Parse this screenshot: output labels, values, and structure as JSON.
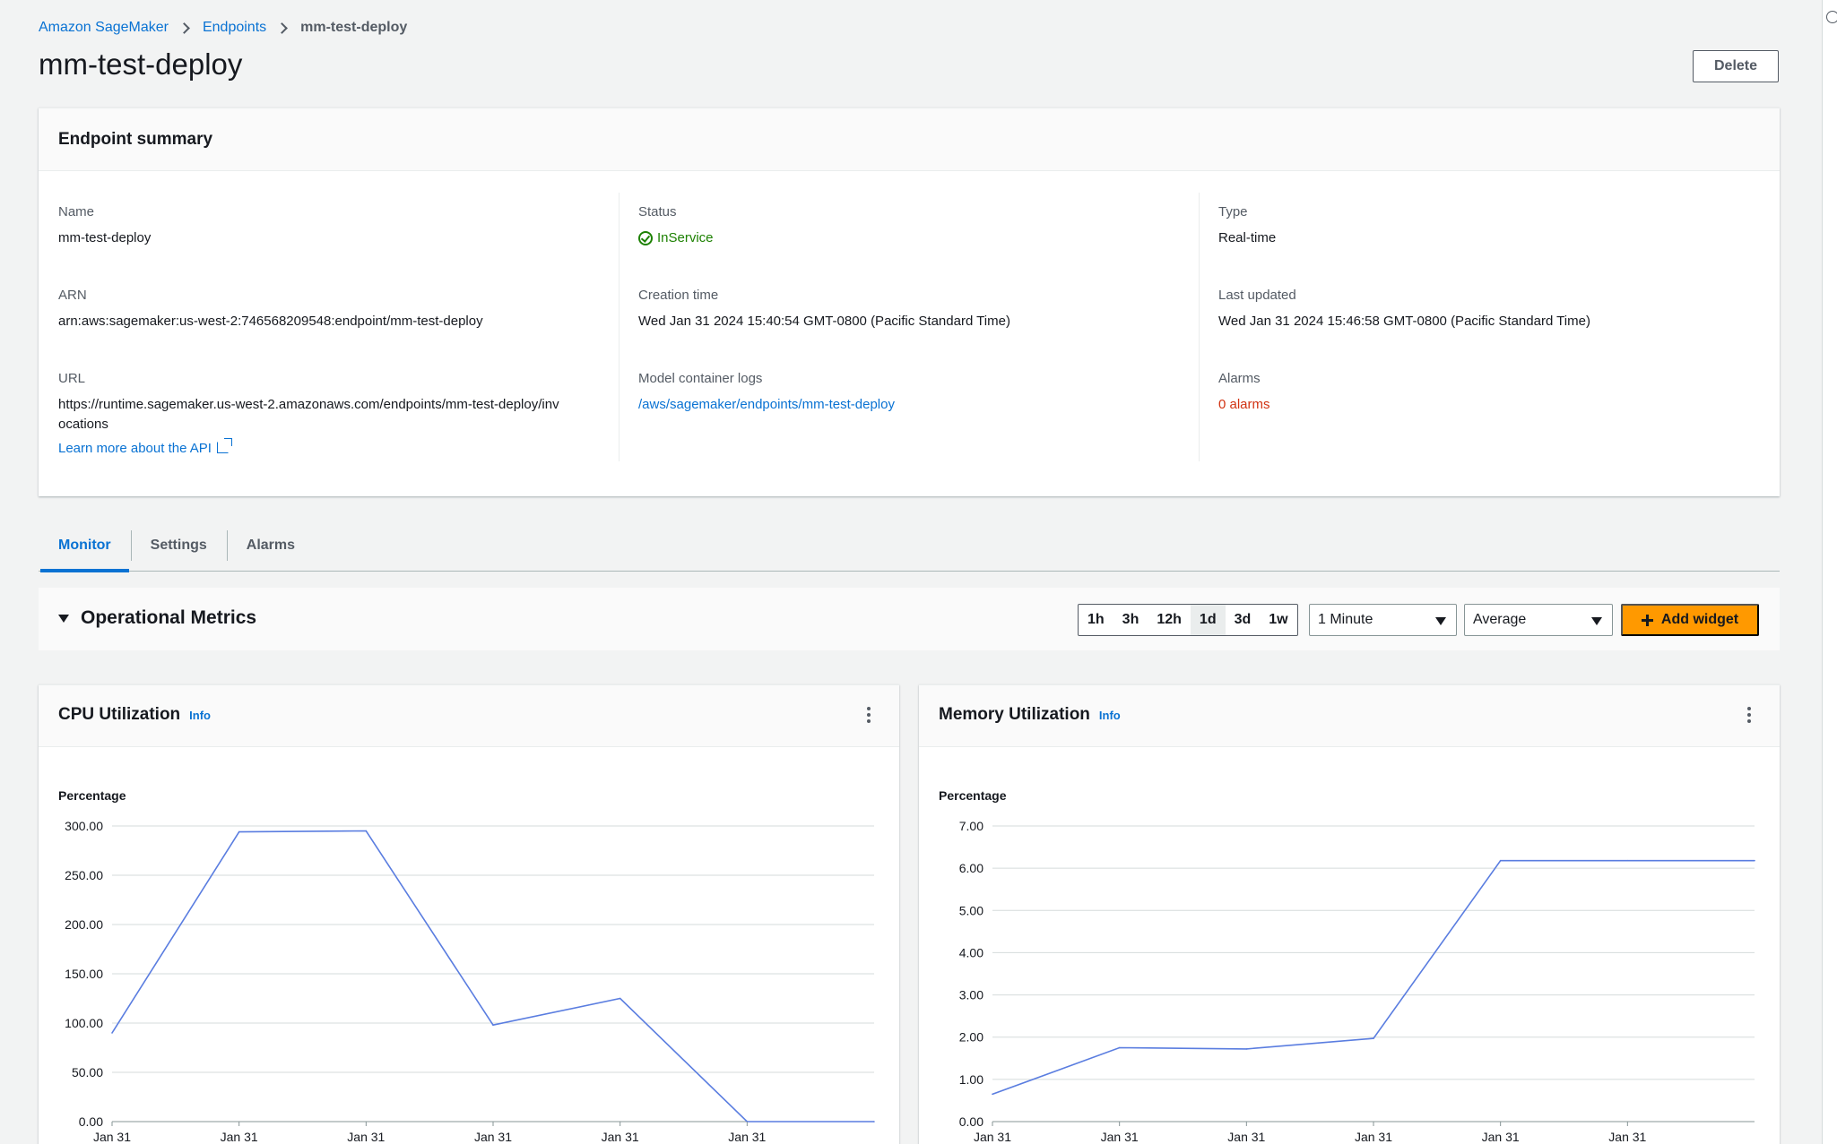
{
  "breadcrumb": {
    "items": [
      "Amazon SageMaker",
      "Endpoints"
    ],
    "current": "mm-test-deploy"
  },
  "page": {
    "title": "mm-test-deploy",
    "delete_label": "Delete"
  },
  "summary": {
    "title": "Endpoint summary",
    "name_label": "Name",
    "name_value": "mm-test-deploy",
    "arn_label": "ARN",
    "arn_value": "arn:aws:sagemaker:us-west-2:746568209548:endpoint/mm-test-deploy",
    "url_label": "URL",
    "url_value": "https://runtime.sagemaker.us-west-2.amazonaws.com/endpoints/mm-test-deploy/invocations",
    "learn_more": "Learn more about the API",
    "status_label": "Status",
    "status_value": "InService",
    "creation_label": "Creation time",
    "creation_value": "Wed Jan 31 2024 15:40:54 GMT-0800 (Pacific Standard Time)",
    "logs_label": "Model container logs",
    "logs_value": "/aws/sagemaker/endpoints/mm-test-deploy",
    "type_label": "Type",
    "type_value": "Real-time",
    "updated_label": "Last updated",
    "updated_value": "Wed Jan 31 2024 15:46:58 GMT-0800 (Pacific Standard Time)",
    "alarms_label": "Alarms",
    "alarms_value": "0 alarms"
  },
  "tabs": [
    {
      "label": "Monitor",
      "active": true
    },
    {
      "label": "Settings",
      "active": false
    },
    {
      "label": "Alarms",
      "active": false
    }
  ],
  "metrics": {
    "title": "Operational Metrics",
    "ranges": [
      "1h",
      "3h",
      "12h",
      "1d",
      "3d",
      "1w"
    ],
    "active_range": "1d",
    "period": "1 Minute",
    "statistic": "Average",
    "add_widget": "Add widget"
  },
  "colors": {
    "accent": "#0972d3",
    "primary_button": "#ff9900",
    "success": "#1d8102",
    "error": "#d13212",
    "series_line": "#5a7de0"
  },
  "chart_data": [
    {
      "type": "line",
      "title": "CPU Utilization",
      "info": "Info",
      "ylabel": "Percentage",
      "ylim": [
        0,
        300
      ],
      "yticks": [
        "300.00",
        "250.00",
        "200.00",
        "150.00",
        "100.00",
        "50.00",
        "0.00"
      ],
      "x": [
        "Jan 31",
        "Jan 31",
        "Jan 31",
        "Jan 31",
        "Jan 31",
        "Jan 31",
        "Jan 31"
      ],
      "values": [
        90,
        294,
        295,
        98,
        125,
        0,
        0
      ],
      "xtick_labels": [
        "Jan 31",
        "Jan 31",
        "Jan 31",
        "Jan 31",
        "Jan 31",
        "Jan 31"
      ],
      "grid": true
    },
    {
      "type": "line",
      "title": "Memory Utilization",
      "info": "Info",
      "ylabel": "Percentage",
      "ylim": [
        0,
        7
      ],
      "yticks": [
        "7.00",
        "6.00",
        "5.00",
        "4.00",
        "3.00",
        "2.00",
        "1.00",
        "0.00"
      ],
      "x": [
        "Jan 31",
        "Jan 31",
        "Jan 31",
        "Jan 31",
        "Jan 31",
        "Jan 31",
        "Jan 31"
      ],
      "values": [
        0.65,
        1.75,
        1.72,
        1.97,
        6.18,
        6.18,
        6.18
      ],
      "xtick_labels": [
        "Jan 31",
        "Jan 31",
        "Jan 31",
        "Jan 31",
        "Jan 31",
        "Jan 31"
      ],
      "grid": true
    }
  ]
}
